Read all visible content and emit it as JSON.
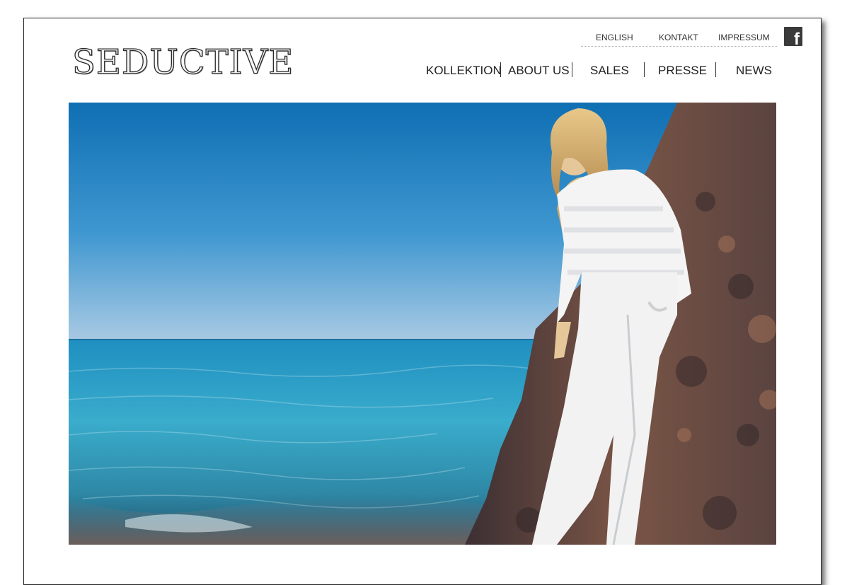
{
  "brand": {
    "logo_text": "SEDUCTIVE"
  },
  "utility_nav": {
    "items": [
      {
        "label": "ENGLISH"
      },
      {
        "label": "KONTAKT"
      },
      {
        "label": "IMPRESSUM"
      }
    ],
    "social": {
      "icon": "facebook-icon",
      "glyph": "f"
    }
  },
  "main_nav": {
    "items": [
      {
        "label": "KOLLEKTION"
      },
      {
        "label": "ABOUT US"
      },
      {
        "label": "SALES"
      },
      {
        "label": "PRESSE"
      },
      {
        "label": "NEWS"
      }
    ]
  },
  "hero": {
    "image": "hero-image-woman-white-outfit-on-rocks-by-sea",
    "colors": {
      "sky": "#1f84c4",
      "horizon": "#8fbfe0",
      "sea": "#2b9ec0",
      "rock": "#6a4b42",
      "outfit": "#f2f2f2"
    }
  }
}
